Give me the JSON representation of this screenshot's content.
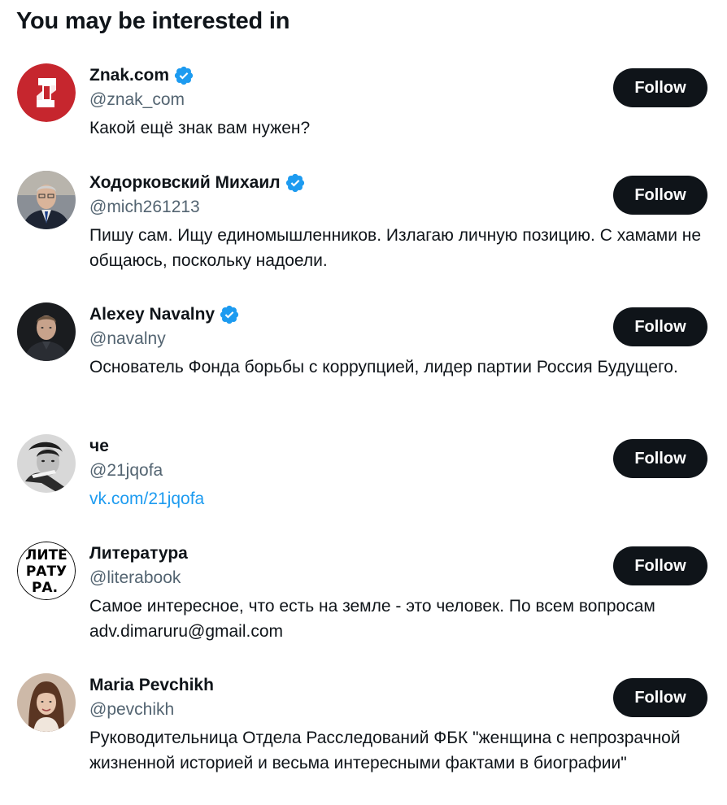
{
  "section": {
    "title": "You may be interested in"
  },
  "colors": {
    "text_primary": "#0f1419",
    "text_secondary": "#536471",
    "link": "#1d9bf0",
    "verified_badge": "#1d9bf0",
    "button_bg": "#0f1419",
    "button_text": "#ffffff"
  },
  "accounts": [
    {
      "name": "Znak.com",
      "handle": "@znak_com",
      "bio": "Какой ещё знак вам нужен?",
      "verified": true,
      "avatar_icon": "znak-logo-icon",
      "follow_label": "Follow"
    },
    {
      "name": "Ходорковский Михаил",
      "handle": "@mich261213",
      "bio": "Пишу сам. Ищу единомышленников. Излагаю личную позицию. С хамами не общаюсь, поскольку надоели.",
      "verified": true,
      "avatar_icon": "portrait-photo-icon",
      "follow_label": "Follow"
    },
    {
      "name": "Alexey Navalny",
      "handle": "@navalny",
      "bio": "Основатель Фонда борьбы с коррупцией, лидер партии Россия Будущего.",
      "verified": true,
      "avatar_icon": "portrait-photo-icon",
      "follow_label": "Follow"
    },
    {
      "name": "че",
      "handle": "@21jqofa",
      "bio": "vk.com/21jqofa",
      "verified": false,
      "avatar_icon": "portrait-photo-icon",
      "follow_label": "Follow"
    },
    {
      "name": "Литература",
      "handle": "@literabook",
      "bio": "Самое интересное, что есть на земле - это человек. По всем вопросам adv.dimaruru@gmail.com",
      "verified": false,
      "avatar_icon": "literatura-logo-icon",
      "avatar_text": "ЛИТЕ РАТУ РА.",
      "follow_label": "Follow"
    },
    {
      "name": "Maria Pevchikh",
      "handle": "@pevchikh",
      "bio": "Руководительница Отдела Расследований ФБК \"женщина с непрозрачной жизненной историей и весьма интересными фактами в биографии\"",
      "verified": false,
      "avatar_icon": "portrait-photo-icon",
      "follow_label": "Follow"
    }
  ]
}
